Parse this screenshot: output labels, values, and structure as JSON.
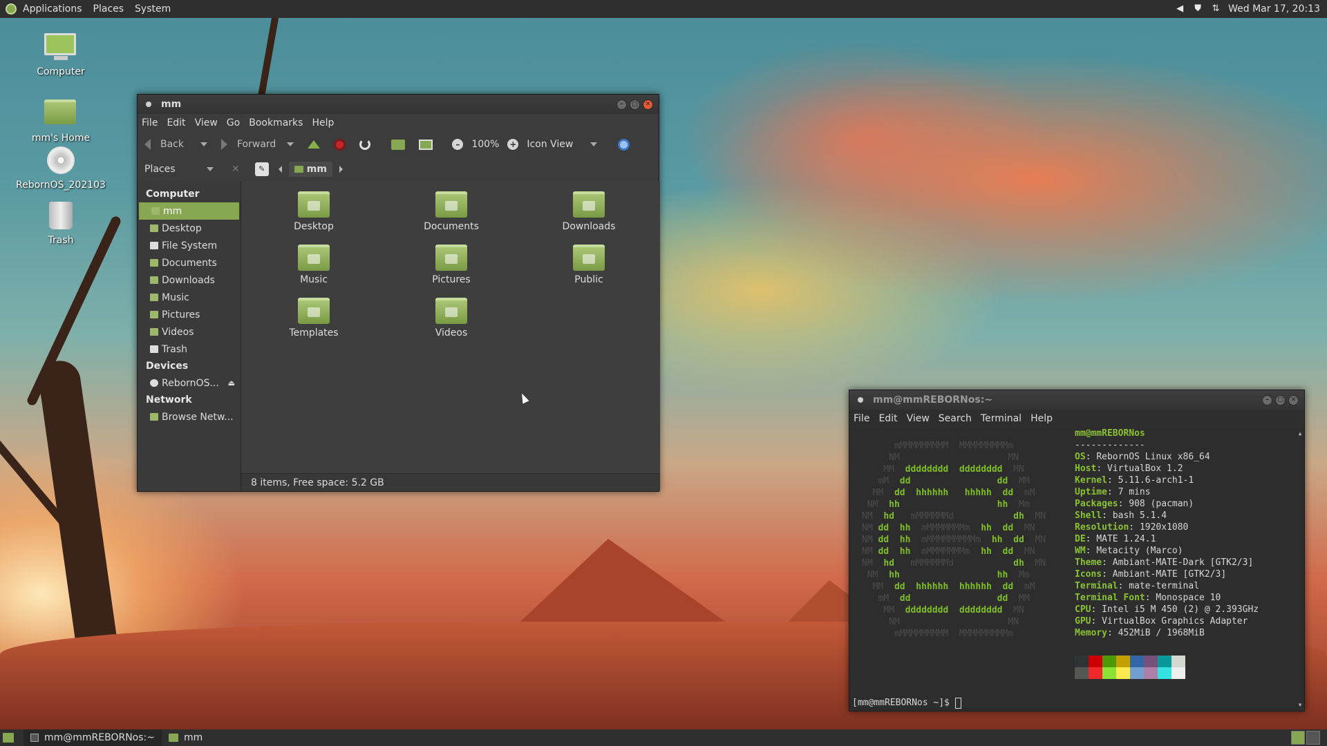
{
  "top_panel": {
    "menus": [
      "Applications",
      "Places",
      "System"
    ],
    "clock": "Wed Mar 17, 20:13"
  },
  "desktop_icons": [
    {
      "label": "Computer",
      "icon": "computer-icon"
    },
    {
      "label": "mm's Home",
      "icon": "home-folder-icon"
    },
    {
      "label": "RebornOS_202103",
      "icon": "disc-icon"
    },
    {
      "label": "Trash",
      "icon": "trash-icon"
    }
  ],
  "file_manager": {
    "title": "mm",
    "menus": [
      "File",
      "Edit",
      "View",
      "Go",
      "Bookmarks",
      "Help"
    ],
    "toolbar": {
      "back": "Back",
      "forward": "Forward",
      "zoom": "100%",
      "view_mode": "Icon View"
    },
    "location": {
      "places_label": "Places",
      "current": "mm"
    },
    "sidebar": {
      "sections": [
        {
          "heading": "Computer",
          "items": [
            "mm",
            "Desktop",
            "File System",
            "Documents",
            "Downloads",
            "Music",
            "Pictures",
            "Videos",
            "Trash"
          ]
        },
        {
          "heading": "Devices",
          "items": [
            "RebornOS..."
          ]
        },
        {
          "heading": "Network",
          "items": [
            "Browse Netw..."
          ]
        }
      ],
      "active": "mm"
    },
    "files": [
      "Desktop",
      "Documents",
      "Downloads",
      "Music",
      "Pictures",
      "Public",
      "Templates",
      "Videos"
    ],
    "status": "8 items, Free space: 5.2 GB"
  },
  "terminal": {
    "title": "mm@mmREBORNos:~",
    "menus": [
      "File",
      "Edit",
      "View",
      "Search",
      "Terminal",
      "Help"
    ],
    "header": "mm@mmREBORNos",
    "separator": "-------------",
    "info": [
      {
        "key": "OS",
        "value": "RebornOS Linux x86_64"
      },
      {
        "key": "Host",
        "value": "VirtualBox 1.2"
      },
      {
        "key": "Kernel",
        "value": "5.11.6-arch1-1"
      },
      {
        "key": "Uptime",
        "value": "7 mins"
      },
      {
        "key": "Packages",
        "value": "908 (pacman)"
      },
      {
        "key": "Shell",
        "value": "bash 5.1.4"
      },
      {
        "key": "Resolution",
        "value": "1920x1080"
      },
      {
        "key": "DE",
        "value": "MATE 1.24.1"
      },
      {
        "key": "WM",
        "value": "Metacity (Marco)"
      },
      {
        "key": "Theme",
        "value": "Ambiant-MATE-Dark [GTK2/3]"
      },
      {
        "key": "Icons",
        "value": "Ambiant-MATE [GTK2/3]"
      },
      {
        "key": "Terminal",
        "value": "mate-terminal"
      },
      {
        "key": "Terminal Font",
        "value": "Monospace 10"
      },
      {
        "key": "CPU",
        "value": "Intel i5 M 450 (2) @ 2.393GHz"
      },
      {
        "key": "GPU",
        "value": "VirtualBox Graphics Adapter"
      },
      {
        "key": "Memory",
        "value": "452MiB / 1968MiB"
      }
    ],
    "palette_top": [
      "#2e3436",
      "#cc0000",
      "#4e9a06",
      "#c4a000",
      "#3465a4",
      "#75507b",
      "#06989a",
      "#d3d7cf"
    ],
    "palette_bottom": [
      "#555753",
      "#ef2929",
      "#8ae234",
      "#fce94f",
      "#729fcf",
      "#ad7fa8",
      "#34e2e2",
      "#eeeeec"
    ],
    "prompt": "[mm@mmREBORNos ~]$ "
  },
  "bottom_panel": {
    "tasks": [
      "mm@mmREBORNos:~",
      "mm"
    ]
  }
}
